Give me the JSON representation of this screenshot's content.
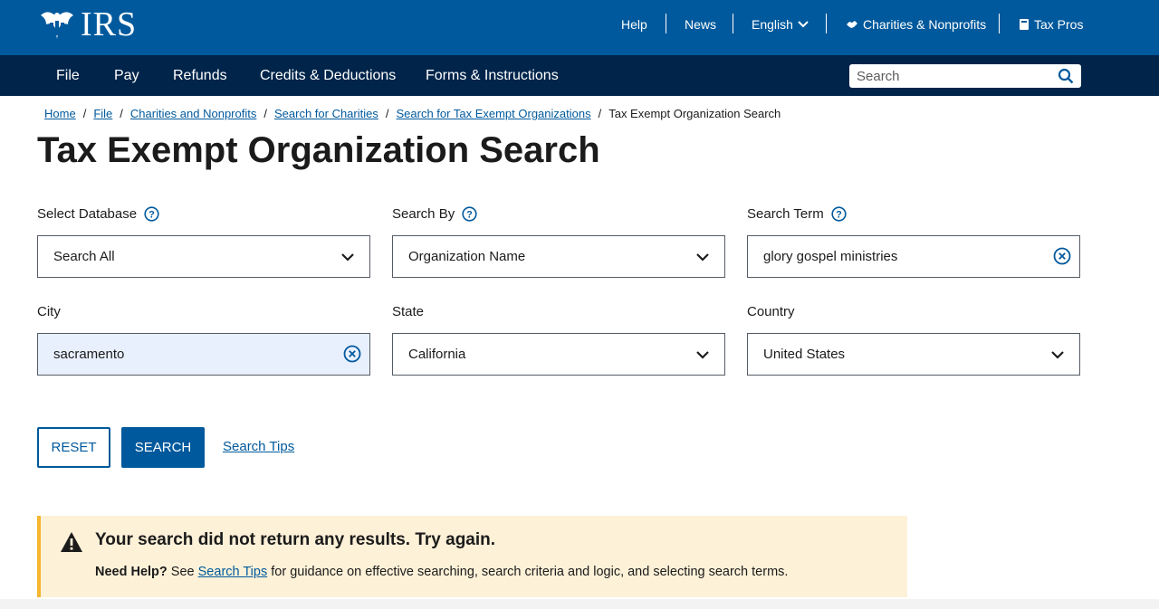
{
  "header": {
    "logo_text": "IRS",
    "utility_links": {
      "help": "Help",
      "news": "News",
      "language": "English",
      "charities": "Charities & Nonprofits",
      "tax_pros": "Tax Pros"
    }
  },
  "nav": {
    "items": [
      "File",
      "Pay",
      "Refunds",
      "Credits & Deductions",
      "Forms & Instructions"
    ],
    "search_placeholder": "Search"
  },
  "breadcrumb": {
    "links": [
      "Home",
      "File",
      "Charities and Nonprofits",
      "Search for Charities",
      "Search for Tax Exempt Organizations"
    ],
    "separator": "/",
    "current": "Tax Exempt Organization Search"
  },
  "page_title": "Tax Exempt Organization Search",
  "form": {
    "select_database": {
      "label": "Select Database",
      "value": "Search All"
    },
    "search_by": {
      "label": "Search By",
      "value": "Organization Name"
    },
    "search_term": {
      "label": "Search Term",
      "value": "glory gospel ministries"
    },
    "city": {
      "label": "City",
      "value": "sacramento"
    },
    "state": {
      "label": "State",
      "value": "California"
    },
    "country": {
      "label": "Country",
      "value": "United States"
    }
  },
  "actions": {
    "reset_label": "RESET",
    "search_label": "SEARCH",
    "tips_label": "Search Tips"
  },
  "alert": {
    "title": "Your search did not return any results. Try again.",
    "help_bold": "Need Help?",
    "help_pre": "See",
    "help_link": "Search Tips",
    "help_post": "for guidance on effective searching, search criteria and logic, and selecting search terms."
  },
  "colors": {
    "top_bar": "#00599c",
    "main_nav": "#00244a",
    "link": "#00599c",
    "alert_bg": "#fdf1d8",
    "alert_border": "#f5b52e",
    "filled_input_bg": "#e8f0fe"
  }
}
